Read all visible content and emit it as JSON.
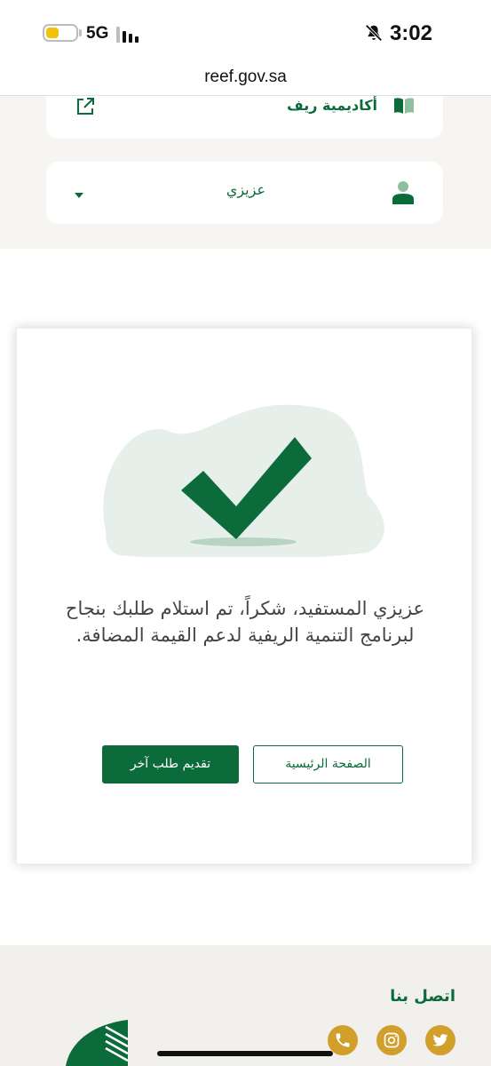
{
  "status_bar": {
    "time": "3:02",
    "network": "5G"
  },
  "browser": {
    "url": "reef.gov.sa"
  },
  "header": {
    "academy_label": "أكاديمية ريف",
    "user_name": "عزيزي"
  },
  "success": {
    "message": "عزيزي المستفيد، شكراً، تم استلام طلبك بنجاح لبرنامج التنمية الريفية لدعم القيمة المضافة.",
    "home_button": "الصفحة الرئيسية",
    "another_request_button": "تقديم طلب آخر"
  },
  "footer": {
    "contact_title": "اتصل بنا"
  },
  "colors": {
    "brand_green": "#0b6b3a",
    "social_gold": "#d39f2b",
    "illustration_bg": "#e6efea"
  },
  "icons": {
    "academy": "book-icon",
    "external": "external-link-icon",
    "user": "user-icon",
    "success": "checkmark-icon",
    "social": [
      "twitter-icon",
      "instagram-icon",
      "phone-icon"
    ]
  }
}
